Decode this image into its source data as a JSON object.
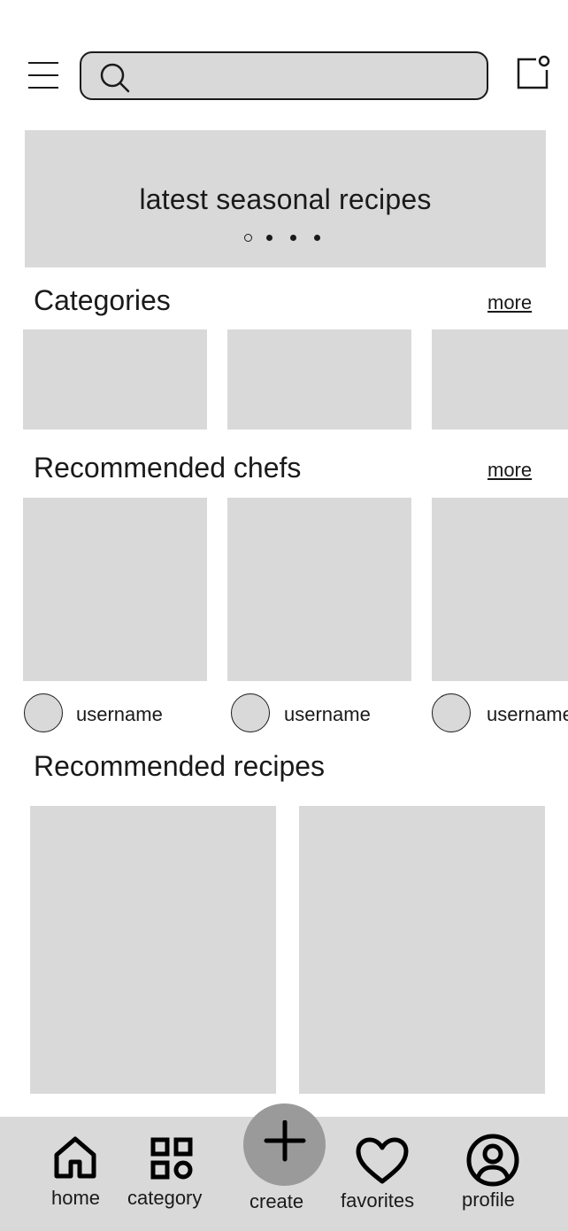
{
  "header": {
    "menu_icon": "hamburger-menu-icon",
    "search_icon": "search-icon",
    "search_placeholder": "",
    "notification_icon": "notification-icon"
  },
  "banner": {
    "title": "latest seasonal recipes",
    "dots": 4,
    "active_dot": 0
  },
  "categories": {
    "title": "Categories",
    "more": "more"
  },
  "chefs": {
    "title": "Recommended chefs",
    "more": "more",
    "items": [
      {
        "username": "username"
      },
      {
        "username": "username"
      },
      {
        "username": "username"
      }
    ]
  },
  "recipes": {
    "title": "Recommended recipes"
  },
  "bottom_nav": {
    "items": [
      {
        "label": "home",
        "icon": "home-icon"
      },
      {
        "label": "category",
        "icon": "category-grid-icon"
      },
      {
        "label": "create",
        "icon": "plus-icon"
      },
      {
        "label": "favorites",
        "icon": "heart-icon"
      },
      {
        "label": "profile",
        "icon": "profile-icon"
      }
    ]
  },
  "colors": {
    "placeholder": "#d9d9d9",
    "nav_bar": "#d9d9d9",
    "create_button": "#9a9a9a",
    "ink": "#1a1a1a"
  }
}
